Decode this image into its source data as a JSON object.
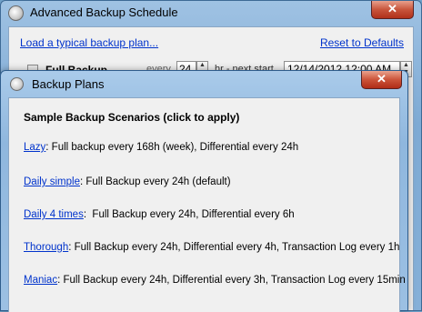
{
  "back_window": {
    "title": "Advanced Backup Schedule",
    "close_glyph": "✕",
    "load_link": "Load a typical backup plan...",
    "reset_link": "Reset to Defaults",
    "row": {
      "label": "Full Backup",
      "every_label": "every",
      "interval_value": "24",
      "hr_label": "hr - next start",
      "next_start_value": "12/14/2012 12:00 AM"
    }
  },
  "front_window": {
    "title": "Backup Plans",
    "close_glyph": "✕",
    "heading": "Sample Backup Scenarios (click to apply)",
    "scenarios": [
      {
        "name": "Lazy",
        "description": ": Full backup every 168h (week), Differential every 24h"
      },
      {
        "name": "Daily simple",
        "description": ": Full Backup every 24h (default)"
      },
      {
        "name": "Daily 4 times",
        "description": ":  Full Backup every 24h, Differential every 6h"
      },
      {
        "name": "Thorough",
        "description": ": Full Backup every 24h, Differential every 4h, Transaction Log every 1h"
      },
      {
        "name": "Maniac",
        "description": ": Full Backup every 24h, Differential every 3h, Transaction Log every 15min"
      }
    ]
  },
  "icons": {
    "app_icon": "clock-icon",
    "close_icon": "close-icon",
    "spin_icon": "spinner-icon"
  }
}
